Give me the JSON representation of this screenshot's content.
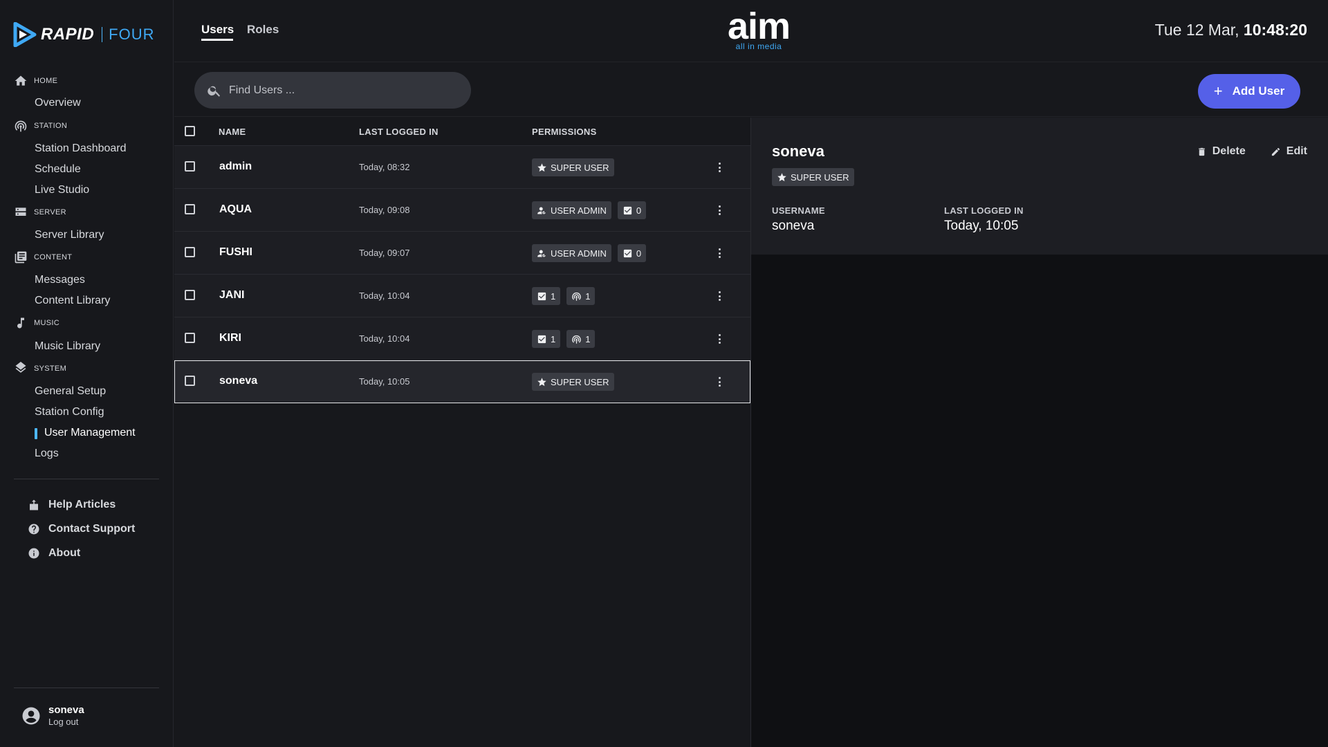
{
  "brand": {
    "name": "RAPID",
    "sub": "FOUR"
  },
  "nav": {
    "sections": [
      {
        "label": "HOME",
        "icon": "home-icon",
        "items": [
          "Overview"
        ]
      },
      {
        "label": "STATION",
        "icon": "antenna-icon",
        "items": [
          "Station Dashboard",
          "Schedule",
          "Live Studio"
        ]
      },
      {
        "label": "SERVER",
        "icon": "server-icon",
        "items": [
          "Server Library"
        ]
      },
      {
        "label": "CONTENT",
        "icon": "library-icon",
        "items": [
          "Messages",
          "Content Library"
        ]
      },
      {
        "label": "MUSIC",
        "icon": "music-note-icon",
        "items": [
          "Music Library"
        ]
      },
      {
        "label": "SYSTEM",
        "icon": "layers-icon",
        "items": [
          "General Setup",
          "Station Config",
          "User Management",
          "Logs"
        ]
      }
    ],
    "active_item": "User Management",
    "help": [
      "Help Articles",
      "Contact Support",
      "About"
    ]
  },
  "current_user": {
    "name": "soneva",
    "logout": "Log out"
  },
  "tabs": [
    "Users",
    "Roles"
  ],
  "active_tab": "Users",
  "center_logo": {
    "main": "aim",
    "sub": "all in media"
  },
  "clock": {
    "date": "Tue 12 Mar,",
    "time": "10:48:20"
  },
  "search": {
    "placeholder": "Find Users ..."
  },
  "add_button": "Add User",
  "table": {
    "headers": [
      "NAME",
      "LAST LOGGED IN",
      "PERMISSIONS"
    ],
    "rows": [
      {
        "name": "admin",
        "last": "Today, 08:32",
        "badges": [
          {
            "icon": "star-icon",
            "text": "SUPER USER"
          }
        ]
      },
      {
        "name": "AQUA",
        "last": "Today, 09:08",
        "badges": [
          {
            "icon": "user-admin-icon",
            "text": "USER ADMIN"
          },
          {
            "icon": "checkbox-icon",
            "text": "0"
          }
        ]
      },
      {
        "name": "FUSHI",
        "last": "Today, 09:07",
        "badges": [
          {
            "icon": "user-admin-icon",
            "text": "USER ADMIN"
          },
          {
            "icon": "checkbox-icon",
            "text": "0"
          }
        ]
      },
      {
        "name": "JANI",
        "last": "Today, 10:04",
        "badges": [
          {
            "icon": "checkbox-icon",
            "text": "1"
          },
          {
            "icon": "antenna-icon",
            "text": "1"
          }
        ]
      },
      {
        "name": "KIRI",
        "last": "Today, 10:04",
        "badges": [
          {
            "icon": "checkbox-icon",
            "text": "1"
          },
          {
            "icon": "antenna-icon",
            "text": "1"
          }
        ]
      },
      {
        "name": "soneva",
        "last": "Today, 10:05",
        "badges": [
          {
            "icon": "star-icon",
            "text": "SUPER USER"
          }
        ]
      }
    ],
    "selected_row": "soneva"
  },
  "detail": {
    "name": "soneva",
    "badge": "SUPER USER",
    "delete": "Delete",
    "edit": "Edit",
    "username_label": "USERNAME",
    "username": "soneva",
    "last_label": "LAST LOGGED IN",
    "last": "Today, 10:05"
  },
  "colors": {
    "accent": "#5560e8",
    "brand_blue": "#3fa9f5",
    "background": "#17181c"
  }
}
